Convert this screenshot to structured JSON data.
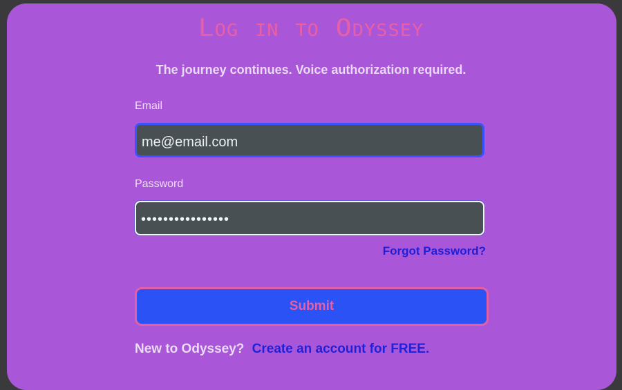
{
  "header": {
    "title": "Log in to Odyssey",
    "subtitle": "The journey continues. Voice authorization required."
  },
  "form": {
    "email_label": "Email",
    "email_value": "me@email.com",
    "password_label": "Password",
    "password_value": "••••••••••••••••",
    "forgot_link": "Forgot Password?",
    "submit_label": "Submit"
  },
  "footer": {
    "question": "New to Odyssey?",
    "create_link": "Create an account for FREE."
  },
  "colors": {
    "card_background": "#a957d8",
    "accent_pink": "#e95fa6",
    "button_blue": "#2a52f5",
    "field_background": "#485054",
    "link_blue": "#1f1fd8"
  }
}
